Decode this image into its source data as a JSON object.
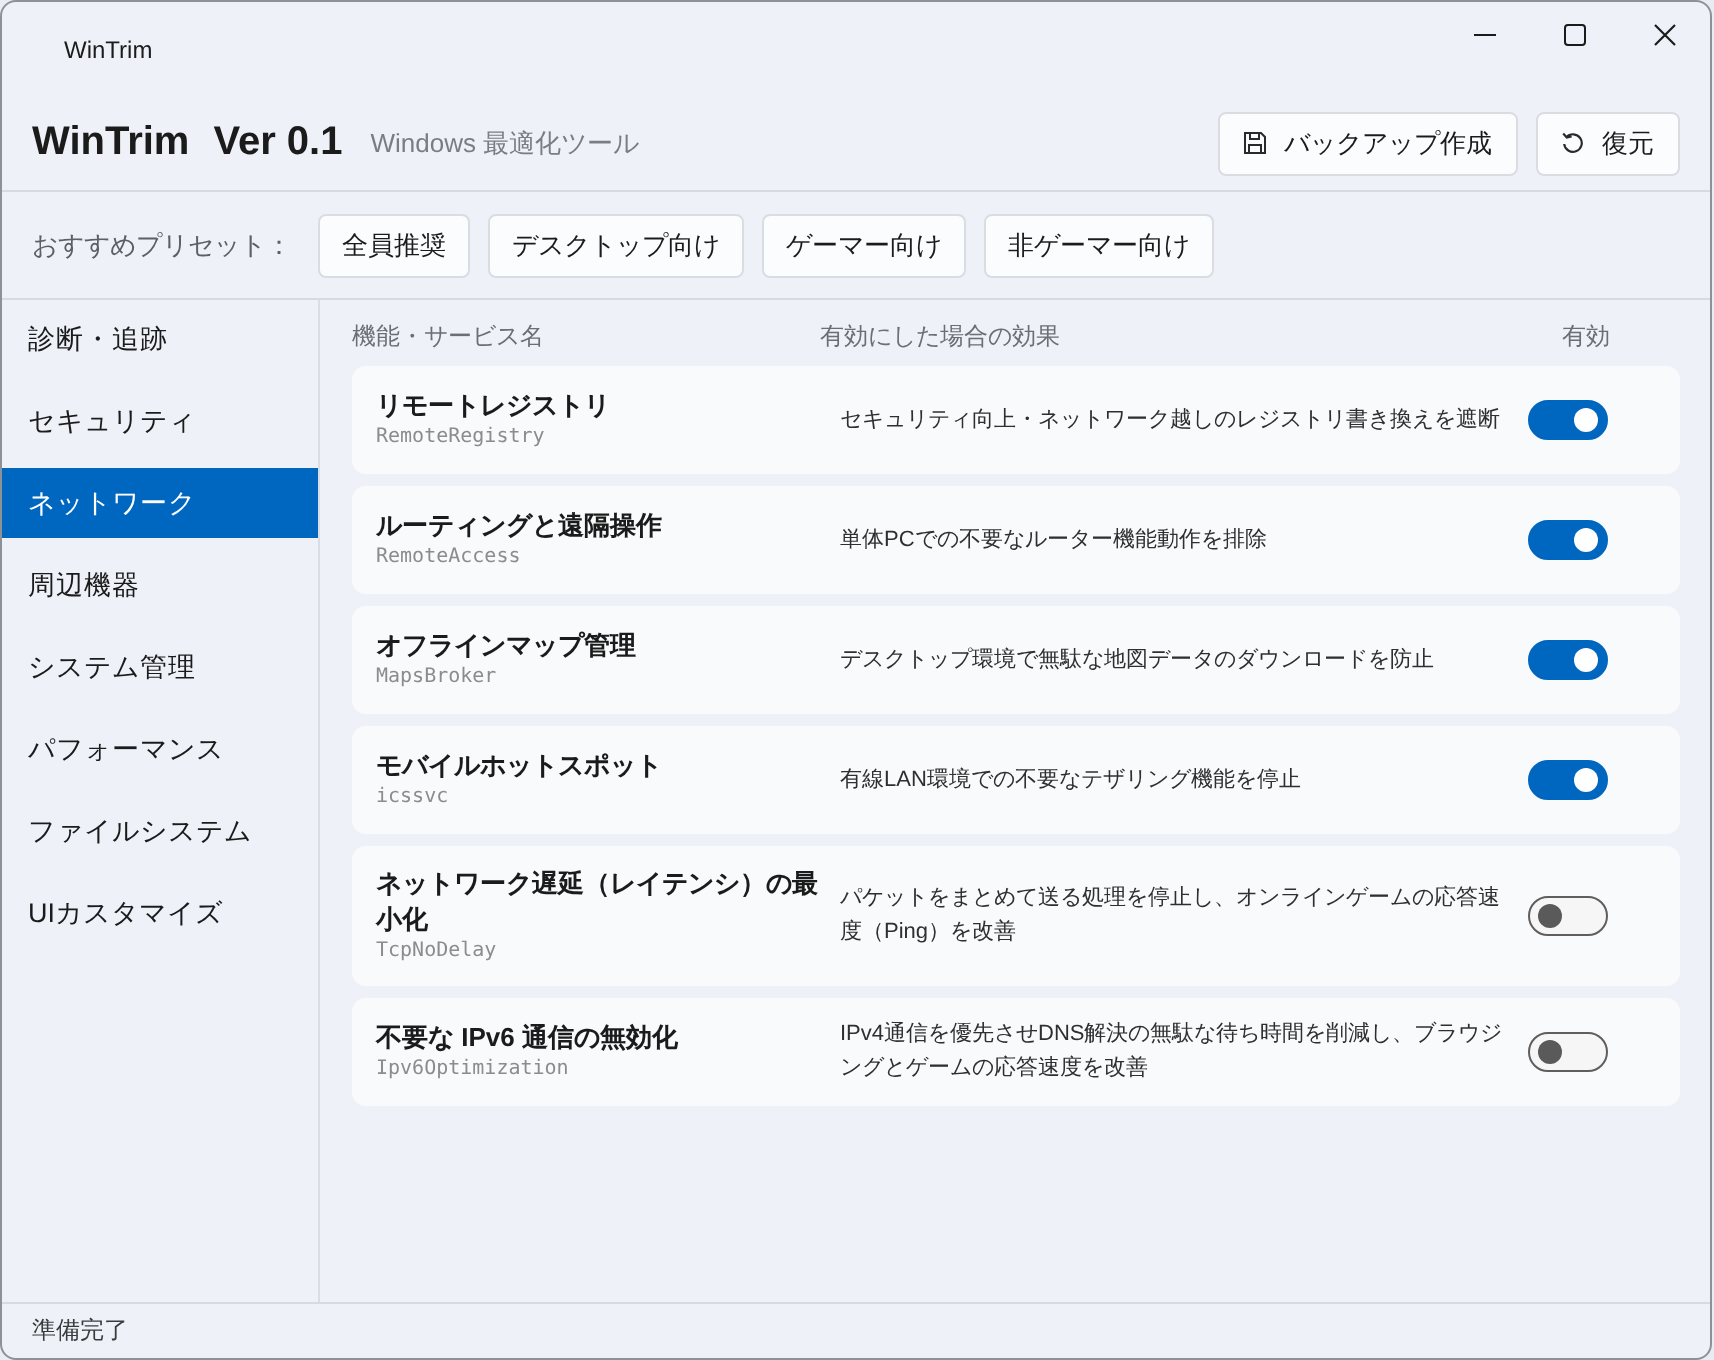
{
  "window": {
    "title": "WinTrim"
  },
  "header": {
    "app_name": "WinTrim",
    "version": "Ver 0.1",
    "subtitle": "Windows 最適化ツール",
    "actions": [
      {
        "kind": "backup",
        "label": "バックアップ作成"
      },
      {
        "kind": "restore",
        "label": "復元"
      }
    ]
  },
  "presets": {
    "label": "おすすめプリセット：",
    "buttons": [
      "全員推奨",
      "デスクトップ向け",
      "ゲーマー向け",
      "非ゲーマー向け"
    ]
  },
  "sidebar": {
    "items": [
      {
        "label": "診断・追跡",
        "selected": false
      },
      {
        "label": "セキュリティ",
        "selected": false
      },
      {
        "label": "ネットワーク",
        "selected": true
      },
      {
        "label": "周辺機器",
        "selected": false
      },
      {
        "label": "システム管理",
        "selected": false
      },
      {
        "label": "パフォーマンス",
        "selected": false
      },
      {
        "label": "ファイルシステム",
        "selected": false
      },
      {
        "label": "UIカスタマイズ",
        "selected": false
      }
    ]
  },
  "table": {
    "columns": [
      "機能・サービス名",
      "有効にした場合の効果",
      "有効"
    ],
    "rows": [
      {
        "name": "リモートレジストリ",
        "service": "RemoteRegistry",
        "effect": "セキュリティ向上・ネットワーク越しのレジストリ書き換えを遮断",
        "on": true
      },
      {
        "name": "ルーティングと遠隔操作",
        "service": "RemoteAccess",
        "effect": "単体PCでの不要なルーター機能動作を排除",
        "on": true
      },
      {
        "name": "オフラインマップ管理",
        "service": "MapsBroker",
        "effect": "デスクトップ環境で無駄な地図データのダウンロードを防止",
        "on": true
      },
      {
        "name": "モバイルホットスポット",
        "service": "icssvc",
        "effect": "有線LAN環境での不要なテザリング機能を停止",
        "on": true
      },
      {
        "name": "ネットワーク遅延（レイテンシ）の最小化",
        "service": "TcpNoDelay",
        "effect": "パケットをまとめて送る処理を停止し、オンラインゲームの応答速度（Ping）を改善",
        "on": false
      },
      {
        "name": "不要な IPv6 通信の無効化",
        "service": "Ipv6Optimization",
        "effect": "IPv4通信を優先させDNS解決の無駄な待ち時間を削減し、ブラウジングとゲームの応答速度を改善",
        "on": false
      }
    ]
  },
  "status_bar": "準備完了"
}
